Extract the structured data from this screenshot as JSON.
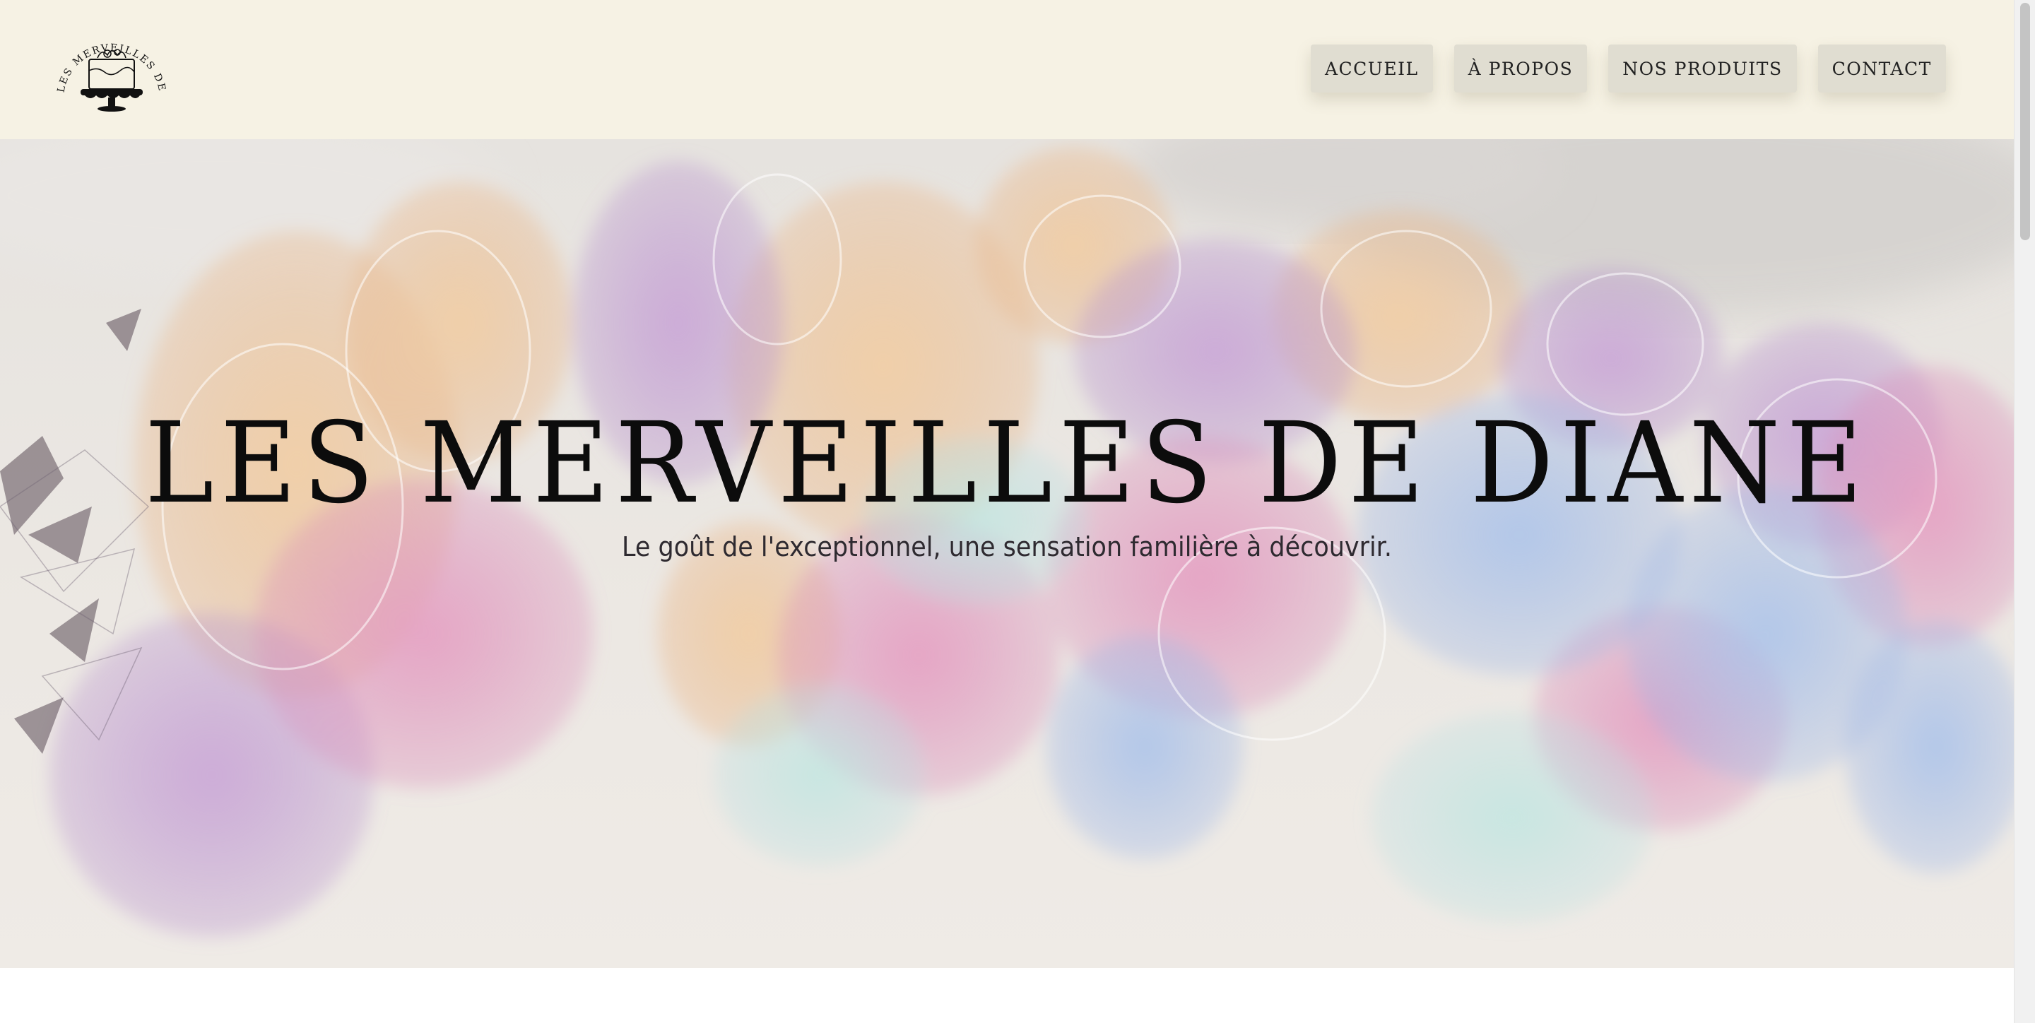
{
  "brand": {
    "logo_text": "LES MERVEILLES DE DIANE",
    "logo_icon": "cake-stand-icon"
  },
  "nav": {
    "items": [
      {
        "label": "ACCUEIL"
      },
      {
        "label": "À PROPOS"
      },
      {
        "label": "NOS PRODUITS"
      },
      {
        "label": "CONTACT"
      }
    ]
  },
  "hero": {
    "title": "LES MERVEILLES DE DIANE",
    "subtitle": "Le goût de l'exceptionnel, une sensation familière à découvrir."
  },
  "colors": {
    "header_bg": "#f6f2e4",
    "nav_button_bg": "#e0ddd1",
    "title_color": "#0c0c0c"
  }
}
